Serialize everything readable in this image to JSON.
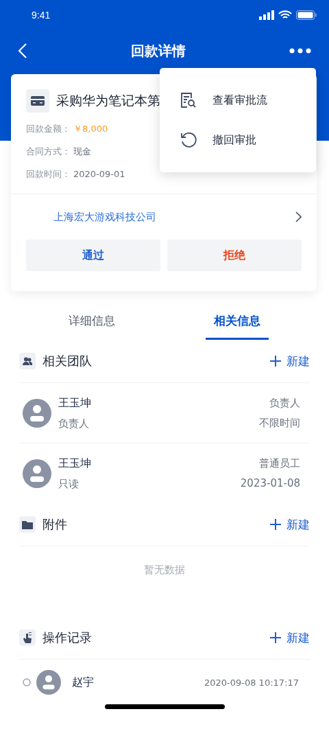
{
  "status_bar": {
    "time": "9:41"
  },
  "nav": {
    "title": "回款详情"
  },
  "card": {
    "title": "采购华为笔记本第",
    "fields": [
      {
        "label": "回款金额：",
        "value": "￥8,000",
        "kind": "amount"
      },
      {
        "label": "合同方式：",
        "value": "现金",
        "kind": "plain"
      },
      {
        "label": "回款时间：",
        "value": "2020-09-01",
        "kind": "plain"
      }
    ],
    "company": "上海宏大游戏科技公司",
    "buttons": [
      {
        "label": "通过",
        "kind": "approve"
      },
      {
        "label": "拒绝",
        "kind": "reject"
      }
    ]
  },
  "menu": [
    {
      "label": "查看审批流",
      "kind": "flow"
    },
    {
      "label": "撤回审批",
      "kind": "revoke"
    }
  ],
  "tabs": [
    {
      "label": "详细信息",
      "selected": false
    },
    {
      "label": "相关信息",
      "selected": true
    }
  ],
  "team": {
    "title": "相关团队",
    "action": "新建",
    "members": [
      {
        "name": "王玉坤",
        "sub": "负责人",
        "role": "负责人",
        "time": "不限时间"
      },
      {
        "name": "王玉坤",
        "sub": "只读",
        "role": "普通员工",
        "time": "2023-01-08"
      }
    ]
  },
  "attachments": {
    "title": "附件",
    "action": "新建",
    "empty": "暂无数据"
  },
  "records": {
    "title": "操作记录",
    "action": "新建",
    "items": [
      {
        "name": "赵宇",
        "time": "2020-09-08 10:17:17"
      }
    ]
  }
}
